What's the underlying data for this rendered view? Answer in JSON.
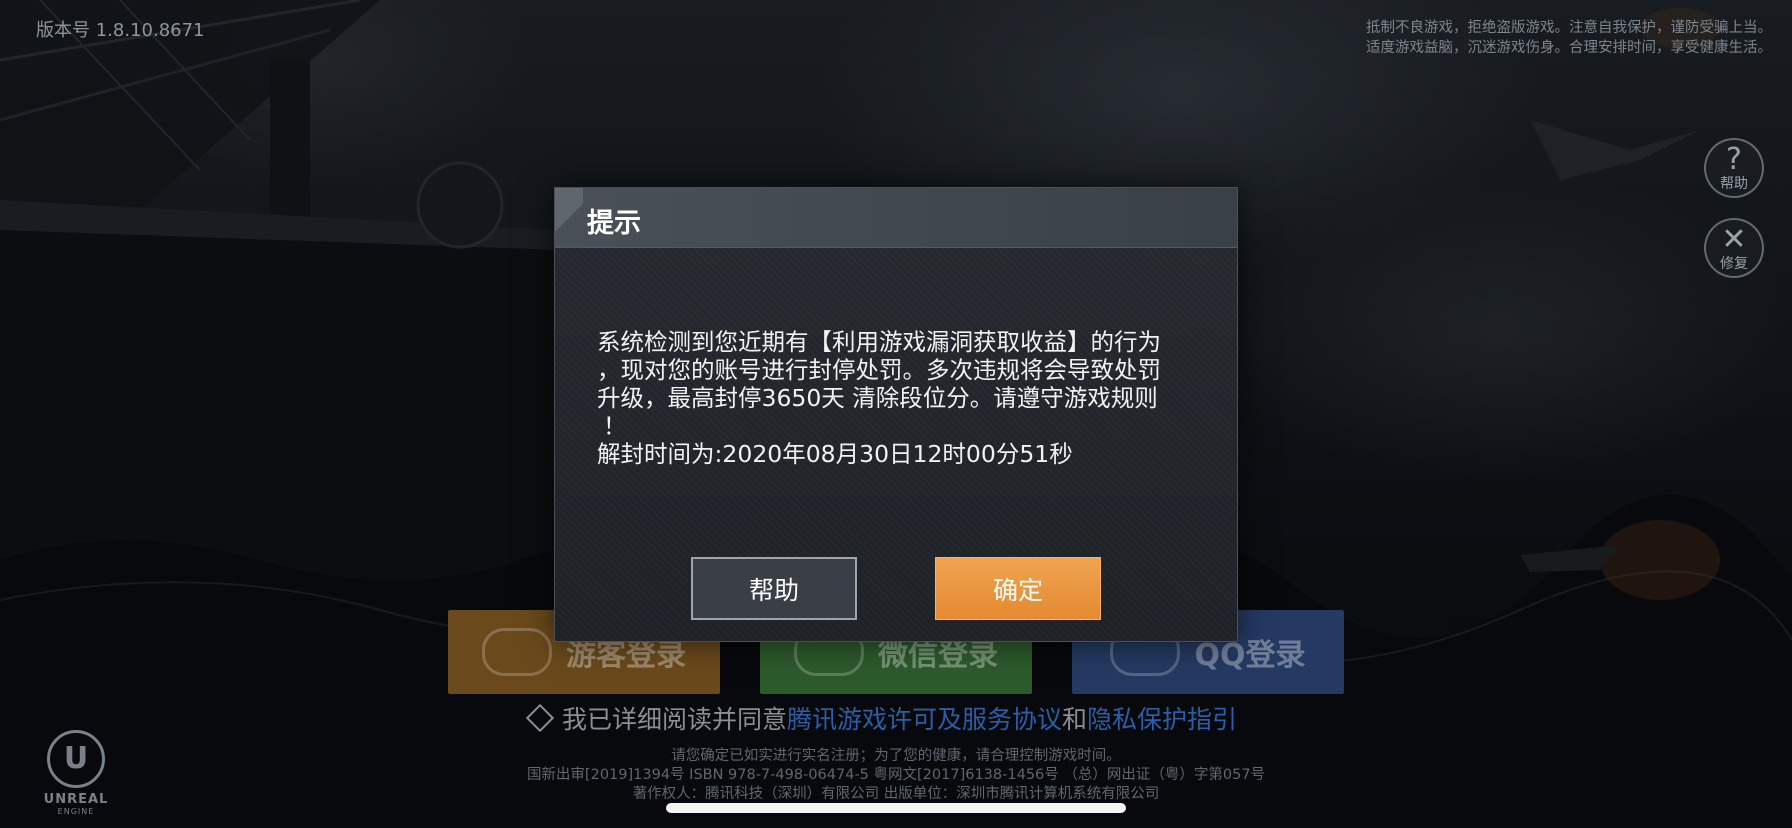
{
  "version": "版本号 1.8.10.8671",
  "top_notice": {
    "line1": "抵制不良游戏，拒绝盗版游戏。注意自我保护，谨防受骗上当。",
    "line2": "适度游戏益脑，沉迷游戏伤身。合理安排时间，享受健康生活。"
  },
  "side_buttons": [
    {
      "icon": "question-icon",
      "glyph": "?",
      "label": "帮助"
    },
    {
      "icon": "wrench-icon",
      "glyph": "✕",
      "label": "修复"
    }
  ],
  "login": {
    "guest": "游客登录",
    "wechat": "微信登录",
    "qq": "QQ登录"
  },
  "agreement": {
    "prefix": "我已详细阅读并同意",
    "link1": "腾讯游戏许可及服务协议",
    "and": "和",
    "link2": "隐私保护指引"
  },
  "footer": {
    "line1": "请您确定已如实进行实名注册；为了您的健康，请合理控制游戏时间。",
    "line2": "国新出审[2019]1394号   ISBN 978-7-498-06474-5   粤网文[2017]6138-1456号  （总）网出证（粤）字第057号",
    "line3": "著作权人：腾讯科技（深圳）有限公司    出版单位：深圳市腾讯计算机系统有限公司"
  },
  "engine": {
    "mark": "U",
    "name": "UNREAL",
    "sub": "ENGINE"
  },
  "dialog": {
    "title": "提示",
    "line1": "系统检测到您近期有【利用游戏漏洞获取收益】的行为",
    "line2": "，现对您的账号进行封停处罚。多次违规将会导致处罚",
    "line3": "升级，最高封停3650天 清除段位分。请遵守游戏规则",
    "line4": "！",
    "unlock_time": "解封时间为:2020年08月30日12时00分51秒",
    "help_label": "帮助",
    "ok_label": "确定"
  },
  "colors": {
    "confirm": "#e8923a",
    "link": "#2a5ea8",
    "guest": "#6a4a1c",
    "wechat": "#2d5a2c",
    "qq": "#243a62"
  }
}
